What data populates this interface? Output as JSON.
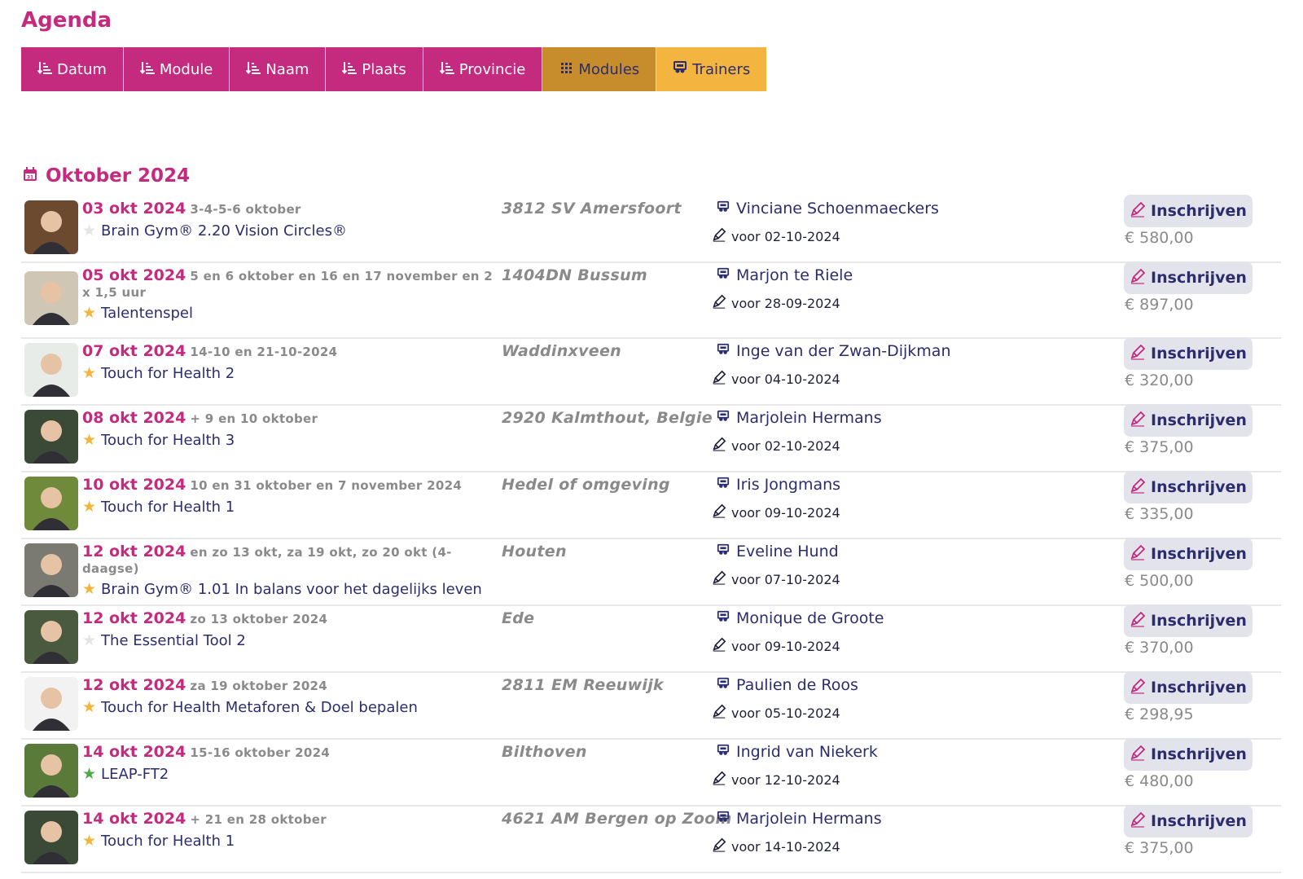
{
  "page": {
    "title": "Agenda"
  },
  "tabs": [
    {
      "label": "Datum",
      "icon": "sort-icon"
    },
    {
      "label": "Module",
      "icon": "sort-icon"
    },
    {
      "label": "Naam",
      "icon": "sort-icon"
    },
    {
      "label": "Plaats",
      "icon": "sort-icon"
    },
    {
      "label": "Provincie",
      "icon": "sort-icon"
    },
    {
      "label": "Modules",
      "icon": "grid-icon"
    },
    {
      "label": "Trainers",
      "icon": "trainer-icon"
    }
  ],
  "colors": {
    "accent": "#c42a7d",
    "modules_tab": "#c78d2c",
    "trainers_tab": "#f3b440",
    "text": "#2b2d6e"
  },
  "month": "Oktober 2024",
  "events": [
    {
      "date": "03 okt 2024",
      "extra": "3-4-5-6 oktober",
      "star": "grey",
      "module": "Brain Gym® 2.20 Vision Circles®",
      "place": "3812 SV Amersfoort",
      "trainer": "Vinciane Schoenmaeckers",
      "deadline": "voor 02-10-2024",
      "signup": "Inschrijven",
      "price": "€ 580,00",
      "avatar_bg": "#6b4a2f"
    },
    {
      "date": "05 okt 2024",
      "extra": "5 en 6 oktober en 16 en 17 november en 2 x 1,5 uur",
      "star": "gold",
      "module": "Talentenspel",
      "place": "1404DN Bussum",
      "trainer": "Marjon te Riele",
      "deadline": "voor 28-09-2024",
      "signup": "Inschrijven",
      "price": "€ 897,00",
      "avatar_bg": "#cfc6b5"
    },
    {
      "date": "07 okt 2024",
      "extra": "14-10 en 21-10-2024",
      "star": "gold",
      "module": "Touch for Health 2",
      "place": "Waddinxveen",
      "trainer": "Inge van der Zwan-Dijkman",
      "deadline": "voor 04-10-2024",
      "signup": "Inschrijven",
      "price": "€ 320,00",
      "avatar_bg": "#e8ece8"
    },
    {
      "date": "08 okt 2024",
      "extra": "+ 9 en 10 oktober",
      "star": "gold",
      "module": "Touch for Health 3",
      "place": "2920 Kalmthout, Belgie",
      "trainer": "Marjolein Hermans",
      "deadline": "voor 02-10-2024",
      "signup": "Inschrijven",
      "price": "€ 375,00",
      "avatar_bg": "#3b4a36"
    },
    {
      "date": "10 okt 2024",
      "extra": "10 en 31 oktober en 7 november 2024",
      "star": "gold",
      "module": "Touch for Health 1",
      "place": "Hedel of omgeving",
      "trainer": "Iris Jongmans",
      "deadline": "voor 09-10-2024",
      "signup": "Inschrijven",
      "price": "€ 335,00",
      "avatar_bg": "#6f8a3a"
    },
    {
      "date": "12 okt 2024",
      "extra": "en zo 13 okt, za 19 okt, zo 20 okt (4-daagse)",
      "star": "gold",
      "module": "Brain Gym® 1.01 In balans voor het dagelijks leven",
      "place": "Houten",
      "trainer": "Eveline Hund",
      "deadline": "voor 07-10-2024",
      "signup": "Inschrijven",
      "price": "€ 500,00",
      "avatar_bg": "#7a7a72"
    },
    {
      "date": "12 okt 2024",
      "extra": "zo 13 oktober 2024",
      "star": "grey",
      "module": "The Essential Tool 2",
      "place": "Ede",
      "trainer": "Monique de Groote",
      "deadline": "voor 09-10-2024",
      "signup": "Inschrijven",
      "price": "€ 370,00",
      "avatar_bg": "#4a5a3e"
    },
    {
      "date": "12 okt 2024",
      "extra": "za 19 oktober 2024",
      "star": "gold",
      "module": "Touch for Health Metaforen & Doel bepalen",
      "place": "2811 EM Reeuwijk",
      "trainer": "Paulien de Roos",
      "deadline": "voor 05-10-2024",
      "signup": "Inschrijven",
      "price": "€ 298,95",
      "avatar_bg": "#f2f2f2"
    },
    {
      "date": "14 okt 2024",
      "extra": "15-16 oktober 2024",
      "star": "green",
      "module": "LEAP-FT2",
      "place": "Bilthoven",
      "trainer": "Ingrid van Niekerk",
      "deadline": "voor 12-10-2024",
      "signup": "Inschrijven",
      "price": "€ 480,00",
      "avatar_bg": "#5a7a3a"
    },
    {
      "date": "14 okt 2024",
      "extra": "+ 21 en 28 oktober",
      "star": "gold",
      "module": "Touch for Health 1",
      "place": "4621 AM Bergen op Zoom",
      "trainer": "Marjolein Hermans",
      "deadline": "voor 14-10-2024",
      "signup": "Inschrijven",
      "price": "€ 375,00",
      "avatar_bg": "#3b4a36"
    }
  ]
}
